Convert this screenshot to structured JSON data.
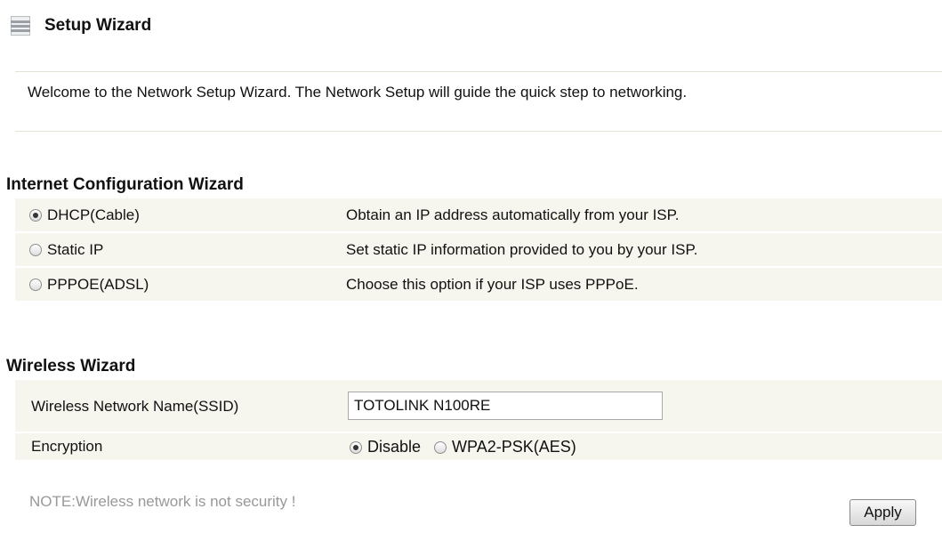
{
  "header": {
    "title": "Setup Wizard"
  },
  "welcome": {
    "text": "Welcome to the Network Setup Wizard. The Network Setup will guide the quick step to networking."
  },
  "internet": {
    "title": "Internet Configuration Wizard",
    "options": [
      {
        "label": "DHCP(Cable)",
        "description": "Obtain an IP address automatically from your ISP.",
        "selected": true
      },
      {
        "label": "Static IP",
        "description": "Set static IP information provided to you by your ISP.",
        "selected": false
      },
      {
        "label": "PPPOE(ADSL)",
        "description": "Choose this option if your ISP uses PPPoE.",
        "selected": false
      }
    ]
  },
  "wireless": {
    "title": "Wireless Wizard",
    "ssid_label": "Wireless Network Name(SSID)",
    "ssid_value": "TOTOLINK N100RE",
    "encryption_label": "Encryption",
    "encryption_options": [
      {
        "label": "Disable",
        "selected": true
      },
      {
        "label": "WPA2-PSK(AES)",
        "selected": false
      }
    ],
    "note": "NOTE:Wireless network is not security !"
  },
  "actions": {
    "apply_label": "Apply"
  }
}
